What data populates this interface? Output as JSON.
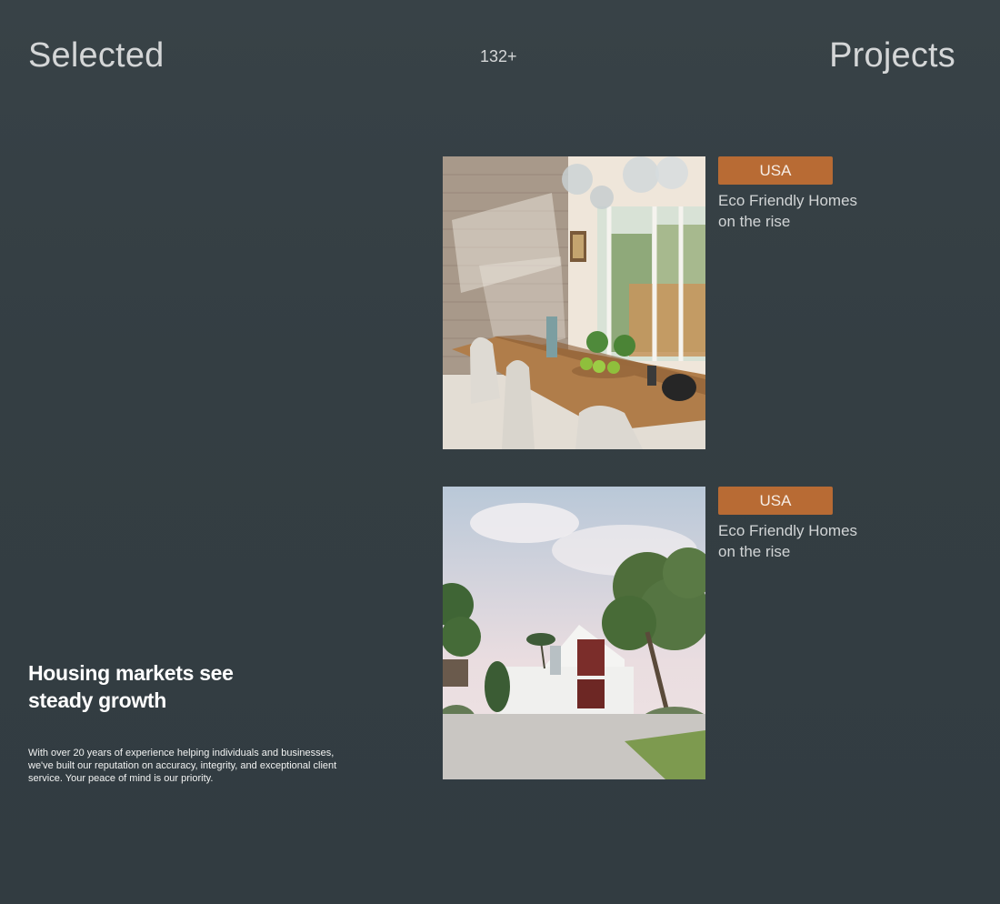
{
  "header": {
    "left_title": "Selected",
    "count": "132+",
    "right_title": "Projects"
  },
  "feature": {
    "title": "Housing markets see steady growth",
    "text": "With over 20 years of experience helping individuals and businesses, we've built our reputation on accuracy, integrity, and exceptional client service. Your peace of mind is our priority."
  },
  "projects": [
    {
      "badge": "USA",
      "title": "Eco Friendly Homes on the rise",
      "image": "dining-room-photo"
    },
    {
      "badge": "USA",
      "title": "Eco Friendly Homes on the rise",
      "image": "white-house-exterior-photo"
    }
  ],
  "colors": {
    "background": "#363f44",
    "badge": "#b86b34"
  }
}
